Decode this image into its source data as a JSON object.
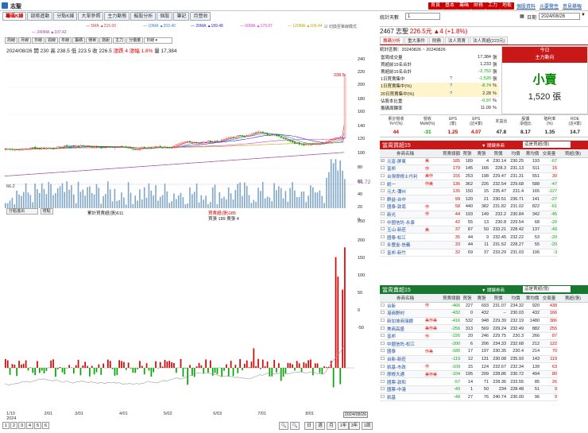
{
  "top": {
    "title": "志聖",
    "red_buttons": [
      "首頁",
      "基本",
      "籌碼",
      "財務",
      "工力",
      "地板"
    ],
    "links": [
      "個股資料",
      "元要警性",
      "意見舉報"
    ]
  },
  "left_tabs": [
    "籌碼K線",
    "部將進動",
    "分點K線",
    "大單參照",
    "主力動態",
    "擬股分析",
    "個股",
    "筆記",
    "月營收"
  ],
  "legend": {
    "ma": [
      {
        "label": "5MA ▲215.00",
        "color": "#d04040"
      },
      {
        "label": "10MA ▲203.40",
        "color": "#3a7bd5"
      },
      {
        "label": "20MA ▲189.48",
        "color": "#2a2ad0"
      },
      {
        "label": "60MA ▲179.97",
        "color": "#d040d0"
      },
      {
        "label": "120MA ▲165.44",
        "color": "#c8a000"
      }
    ],
    "ma2": {
      "label": "240MA ▲107.42",
      "color": "#a040a0"
    },
    "toggle": "☑ 切換至單線模式"
  },
  "toolbar": {
    "buttons": [
      "周線",
      "月線",
      "日線",
      "週線",
      "年線",
      "籌碼",
      "傳單",
      "測距",
      "主力",
      "分價量"
    ],
    "select": "日線"
  },
  "ohlc": {
    "date": "2024/08/26",
    "open_label": "開",
    "open": "230",
    "high_label": "高",
    "high": "238.5",
    "low_label": "低",
    "low": "223.5",
    "close_label": "收",
    "close": "226.5",
    "change": "漲跌 4",
    "pct": "漲幅 1.8%",
    "vol_label": "量",
    "vol": "17,384"
  },
  "price_marks": {
    "top": "238.5",
    "left": "66.2",
    "right": "61.72"
  },
  "right_axis": [
    "240",
    "220",
    "200",
    "180",
    "160",
    "140",
    "120",
    "100",
    "80",
    "60",
    "40",
    "20",
    "0",
    "250",
    "200",
    "150",
    "100",
    "50",
    "0",
    "-50"
  ],
  "sub_panel": {
    "select": "分點進出",
    "btn": "增點",
    "legend_left": "累計買賣超(張)611",
    "legend_right1": "買賣超(張)185",
    "legend_right2": "買張 189 賣張 4"
  },
  "x_ticks": [
    {
      "label": "1/10\n2024",
      "x": 0.5
    },
    {
      "label": "2/01",
      "x": 11.5
    },
    {
      "label": "3/01",
      "x": 20.5
    },
    {
      "label": "4/01",
      "x": 33.5
    },
    {
      "label": "5/02",
      "x": 46.5
    },
    {
      "label": "6/03",
      "x": 61
    },
    {
      "label": "7/01",
      "x": 74
    },
    {
      "label": "8/01",
      "x": 88
    },
    {
      "label": "2024/08/26",
      "x": 99
    }
  ],
  "bottom": {
    "pages": [
      "1",
      "2",
      "3",
      "4",
      "5",
      "6"
    ],
    "period_buttons": [
      "日",
      "週",
      "月",
      "1年",
      "3年",
      "1周"
    ],
    "zoom": [
      "🔍",
      "🔍"
    ]
  },
  "right": {
    "stat_days_label": "統計天數",
    "stat_days_value": "1",
    "date_label": "日期",
    "date_value": "2024/08/26",
    "headline": {
      "name": "2467 志聖",
      "price": "226.5元",
      "change": "▲4 (+1.8%)"
    },
    "tabs": [
      "籌碼分析",
      "重大事件",
      "財務",
      "法人買賣",
      "法人買超(223元)"
    ],
    "summary": {
      "period": "統計區間：20240826 ~ 20240826",
      "rows": [
        {
          "label": "當周成交量",
          "value": "17,384",
          "unit": "張"
        },
        {
          "label": "買超前15名合計",
          "value": "1,233",
          "unit": "張"
        },
        {
          "label": "賣超前15名合計",
          "value": "-2,753",
          "unit": "張"
        },
        {
          "label": "1日買賣集中",
          "value": "-1,520",
          "unit": "張"
        },
        {
          "label": "1日買賣集中(%)",
          "value": "-8.74",
          "unit": "%"
        },
        {
          "label": "20日買賣集中(%)",
          "value": "2.28",
          "unit": "%"
        },
        {
          "label": "佔股本比重",
          "value": "-0.97",
          "unit": "%"
        },
        {
          "label": "籌碼周轉率",
          "value": "11.09",
          "unit": "%"
        }
      ],
      "box_title1": "今日",
      "box_title2": "主力動向",
      "box_main": "小賣",
      "box_sub": "1,520 張"
    },
    "kpi": {
      "headers": [
        "累計營收\nYoY(%)",
        "營收\nMoM(%)",
        "EPS\n(季)",
        "EPS\n(近4季)",
        "本益比",
        "股價\n淨值比",
        "殖利率\n(%)",
        "ROE\n(近4季)"
      ],
      "values": [
        "44",
        "-31",
        "1.25",
        "4.07",
        "47.8",
        "8.17",
        "1.35",
        "14.7"
      ]
    },
    "buy_section": {
      "title": "當周買超15",
      "filter_label": "▼ 關鍵券商",
      "filter_select": "這是買超(億)",
      "headers": [
        "",
        "券商名稱",
        "買賣總額",
        "買張",
        "賣張",
        "買價",
        "均價",
        "賣均價",
        "交易量",
        "買超(張)"
      ],
      "rows": [
        [
          "☑",
          "元富-屏東",
          "美",
          "185",
          "189",
          "4",
          "230.14",
          "230.25",
          "193",
          "-67"
        ],
        [
          "☐",
          "富邦",
          "作",
          "179",
          "145",
          "166",
          "228.3",
          "231.13",
          "511",
          "15"
        ],
        [
          "☐",
          "台灣摩根士丹利",
          "美作",
          "155",
          "253",
          "198",
          "229.47",
          "231.31",
          "551",
          "30"
        ],
        [
          "☐",
          "統一",
          "作美",
          "136",
          "362",
          "226",
          "232.54",
          "229.68",
          "588",
          "-47"
        ],
        [
          "☐",
          "元大-彌州",
          "",
          "135",
          "150",
          "15",
          "235.47",
          "231.4",
          "165",
          "-127"
        ],
        [
          "☐",
          "群益-台中",
          "",
          "99",
          "120",
          "21",
          "230.51",
          "236.71",
          "141",
          "-27"
        ],
        [
          "☐",
          "國泰-敦南",
          "作",
          "58",
          "440",
          "382",
          "231.82",
          "231.02",
          "822",
          "-61"
        ],
        [
          "☐",
          "新光",
          "作",
          "44",
          "193",
          "149",
          "232.2",
          "230.84",
          "342",
          "-45"
        ],
        [
          "☐",
          "中國信託-永康",
          "",
          "42",
          "55",
          "13",
          "230.8",
          "229.54",
          "68",
          "-20"
        ],
        [
          "☐",
          "玉山-新莊",
          "美",
          "37",
          "87",
          "50",
          "233.21",
          "228.42",
          "137",
          "-49"
        ],
        [
          "☐",
          "國泰-松江",
          "",
          "35",
          "44",
          "9",
          "232.45",
          "232.22",
          "53",
          "-20"
        ],
        [
          "☐",
          "永豐金-信義",
          "",
          "33",
          "44",
          "11",
          "231.52",
          "228.27",
          "55",
          "-20"
        ],
        [
          "☐",
          "富邦-新竹",
          "",
          "32",
          "69",
          "37",
          "233.29",
          "231.03",
          "106",
          "-3"
        ]
      ]
    },
    "sell_section": {
      "title": "當周賣超15",
      "filter_label": "▼ 關鍵券商",
      "filter_select": "這是賣超(億)",
      "headers": [
        "",
        "券商名稱",
        "買賣總額",
        "買張",
        "賣張",
        "買價",
        "均價",
        "賣均價",
        "交易量",
        "賣超(張)"
      ],
      "rows": [
        [
          "☐",
          "台新",
          "作",
          "-466",
          "227",
          "693",
          "231.07",
          "234.32",
          "920",
          "438"
        ],
        [
          "☐",
          "港商野村",
          "",
          "-432",
          "0",
          "432",
          "--",
          "230.03",
          "432",
          "166"
        ],
        [
          "☐",
          "新加坡商瑞銀",
          "美作美",
          "-416",
          "532",
          "948",
          "229.39",
          "232.19",
          "1480",
          "386"
        ],
        [
          "☐",
          "美商高盛",
          "美作美",
          "-256",
          "313",
          "569",
          "229.24",
          "232.49",
          "882",
          "255"
        ],
        [
          "☐",
          "富邦",
          "作",
          "-226",
          "20",
          "246",
          "229.75",
          "230.3",
          "266",
          "87"
        ],
        [
          "☐",
          "中國信託-松江",
          "",
          "-200",
          "6",
          "206",
          "234.33",
          "232.68",
          "212",
          "122"
        ],
        [
          "☐",
          "國泰",
          "作美",
          "-180",
          "17",
          "197",
          "230.35",
          "230.4",
          "214",
          "70"
        ],
        [
          "☐",
          "台新-新莊",
          "",
          "-119",
          "12",
          "131",
          "230.08",
          "235.93",
          "143",
          "119"
        ],
        [
          "☐",
          "凱基-市政",
          "作",
          "-109",
          "15",
          "124",
          "232.67",
          "232.34",
          "139",
          "63"
        ],
        [
          "☐",
          "摩根大通",
          "美作美",
          "-104",
          "195",
          "299",
          "228.86",
          "230.72",
          "494",
          "80"
        ],
        [
          "☐",
          "國票-敦和",
          "",
          "-57",
          "14",
          "71",
          "228.36",
          "233.55",
          "85",
          "26"
        ],
        [
          "☐",
          "國票-中港",
          "",
          "-49",
          "1",
          "50",
          "234",
          "228.48",
          "51",
          "9"
        ],
        [
          "☐",
          "凱基",
          "",
          "-48",
          "27",
          "76",
          "240.74",
          "230.00",
          "96",
          "9"
        ]
      ]
    }
  }
}
